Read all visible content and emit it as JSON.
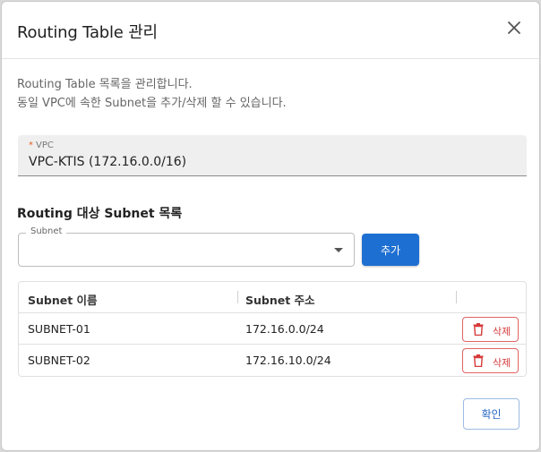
{
  "dialog": {
    "title": "Routing Table 관리",
    "description_line1": "Routing Table 목록을 관리합니다.",
    "description_line2": "동일 VPC에 속한 Subnet을 추가/삭제 할 수 있습니다."
  },
  "vpc": {
    "required_mark": "*",
    "label": "VPC",
    "value": "VPC-KTIS (172.16.0.0/16)"
  },
  "subnet_section": {
    "title": "Routing 대상 Subnet 목록",
    "select_label": "Subnet",
    "select_value": "",
    "add_label": "추가"
  },
  "table": {
    "columns": [
      "Subnet 이름",
      "Subnet 주소"
    ],
    "rows": [
      {
        "name": "SUBNET-01",
        "address": "172.16.0.0/24",
        "delete_label": "삭제"
      },
      {
        "name": "SUBNET-02",
        "address": "172.16.10.0/24",
        "delete_label": "삭제"
      }
    ]
  },
  "footer": {
    "confirm_label": "확인"
  },
  "icons": {
    "close": "close-icon",
    "delete": "trash-icon",
    "select": "caret-down-icon"
  },
  "colors": {
    "primary": "#1e6fd2",
    "danger": "#d63a3a",
    "required": "#e25c1e"
  }
}
